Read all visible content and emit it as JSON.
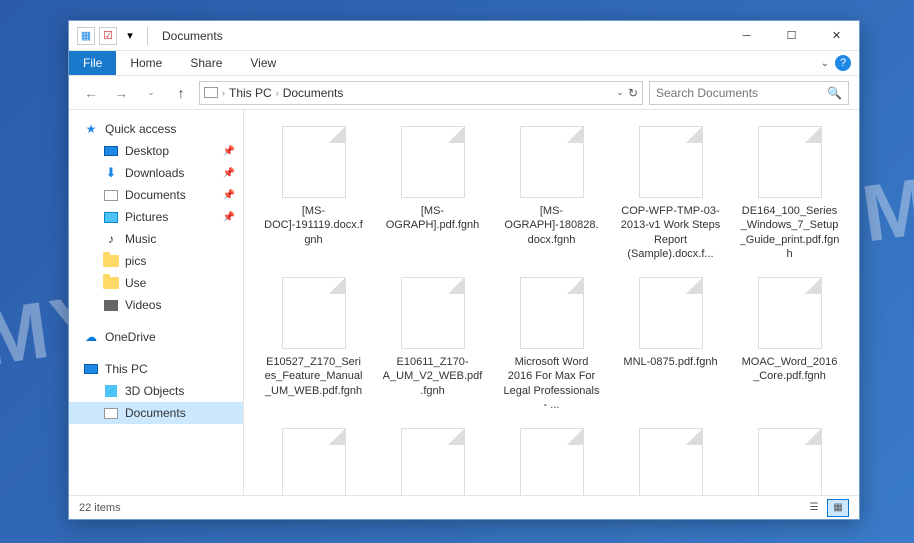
{
  "window": {
    "title": "Documents"
  },
  "ribbon": {
    "file": "File",
    "home": "Home",
    "share": "Share",
    "view": "View"
  },
  "breadcrumb": {
    "root": "This PC",
    "current": "Documents"
  },
  "search": {
    "placeholder": "Search Documents"
  },
  "sidebar": {
    "quick_access": "Quick access",
    "desktop": "Desktop",
    "downloads": "Downloads",
    "documents": "Documents",
    "pictures": "Pictures",
    "music": "Music",
    "pics": "pics",
    "use": "Use",
    "videos": "Videos",
    "onedrive": "OneDrive",
    "this_pc": "This PC",
    "objects_3d": "3D Objects",
    "documents2": "Documents"
  },
  "files": [
    {
      "name": "[MS-DOC]-191119.docx.fgnh"
    },
    {
      "name": "[MS-OGRAPH].pdf.fgnh"
    },
    {
      "name": "[MS-OGRAPH]-180828.docx.fgnh"
    },
    {
      "name": "COP-WFP-TMP-03-2013-v1 Work Steps Report (Sample).docx.f..."
    },
    {
      "name": "DE164_100_Series_Windows_7_Setup_Guide_print.pdf.fgnh"
    },
    {
      "name": "E10527_Z170_Series_Feature_Manual_UM_WEB.pdf.fgnh"
    },
    {
      "name": "E10611_Z170-A_UM_V2_WEB.pdf.fgnh"
    },
    {
      "name": "Microsoft Word 2016 For Max For Legal Professionals - ..."
    },
    {
      "name": "MNL-0875.pdf.fgnh"
    },
    {
      "name": "MOAC_Word_2016_Core.pdf.fgnh"
    }
  ],
  "status": {
    "item_count": "22 items"
  }
}
